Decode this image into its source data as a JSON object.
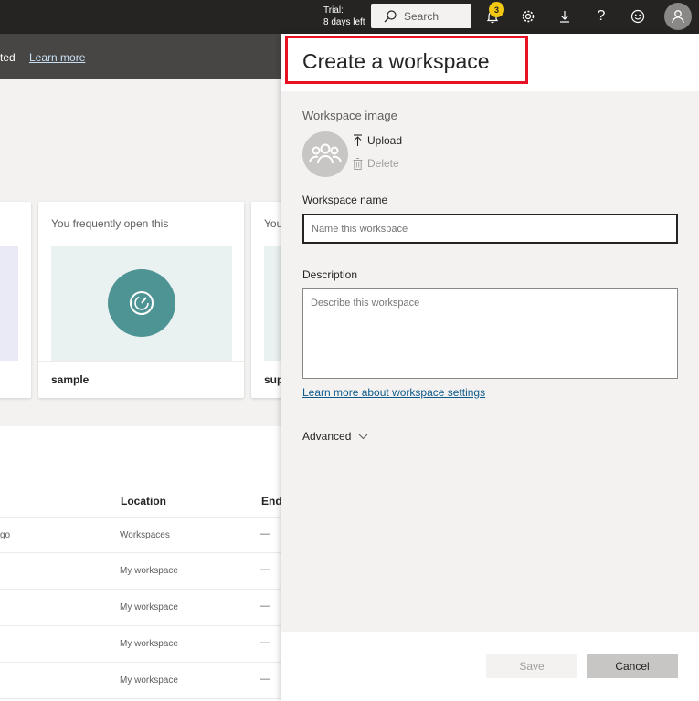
{
  "topbar": {
    "trial_line1": "Trial:",
    "trial_line2": "8 days left",
    "search_label": "Search",
    "notification_count": "3",
    "icons": [
      "bell-icon",
      "gear-icon",
      "download-icon",
      "help-icon",
      "smiley-icon",
      "user-icon"
    ]
  },
  "background": {
    "subheader_partial": "ted",
    "learn_more": "Learn more",
    "cards": [
      {
        "caption": "You frequently open this",
        "name": "sample"
      },
      {
        "caption": "You",
        "name": "sup"
      }
    ],
    "table": {
      "headers": [
        "Location",
        "Endo"
      ],
      "rows": [
        {
          "c1": "go",
          "location": "Workspaces",
          "endorsement": "—"
        },
        {
          "c1": "",
          "location": "My workspace",
          "endorsement": "—"
        },
        {
          "c1": "",
          "location": "My workspace",
          "endorsement": "—"
        },
        {
          "c1": "",
          "location": "My workspace",
          "endorsement": "—"
        },
        {
          "c1": "",
          "location": "My workspace",
          "endorsement": "—"
        }
      ]
    }
  },
  "panel": {
    "title": "Create a workspace",
    "workspace_image_label": "Workspace image",
    "upload_label": "Upload",
    "delete_label": "Delete",
    "workspace_name_label": "Workspace name",
    "workspace_name_placeholder": "Name this workspace",
    "description_label": "Description",
    "description_placeholder": "Describe this workspace",
    "settings_link": "Learn more about workspace settings",
    "advanced_label": "Advanced",
    "save_label": "Save",
    "cancel_label": "Cancel"
  },
  "colors": {
    "topbar": "#252423",
    "highlight_border": "#e81123",
    "badge": "#f2c811",
    "teal": "#4e9495",
    "link": "#0e5a8a"
  }
}
